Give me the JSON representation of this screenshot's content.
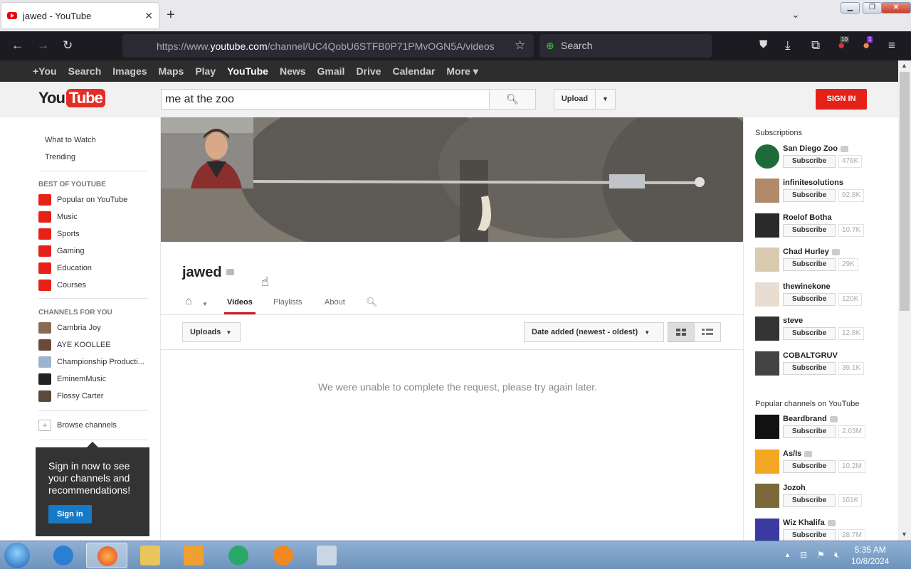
{
  "browser": {
    "tab_title": "jawed - YouTube",
    "url_pre": "https://www.",
    "url_domain": "youtube.com",
    "url_path": "/channel/UC4QobU6STFB0P71PMvOGN5A/videos",
    "search_placeholder": "Search",
    "badge_ext1": "10",
    "badge_ext2": "1"
  },
  "google_bar": {
    "items": [
      "+You",
      "Search",
      "Images",
      "Maps",
      "Play",
      "YouTube",
      "News",
      "Gmail",
      "Drive",
      "Calendar",
      "More ▾"
    ]
  },
  "masthead": {
    "logo_you": "You",
    "logo_tube": "Tube",
    "search_value": "me at the zoo",
    "upload_label": "Upload",
    "signin_label": "SIGN IN"
  },
  "guide": {
    "links": [
      "What to Watch",
      "Trending"
    ],
    "best_of_header": "BEST OF YOUTUBE",
    "best_of": [
      {
        "label": "Popular on YouTube",
        "color": "#e62117"
      },
      {
        "label": "Music",
        "color": "#e62117"
      },
      {
        "label": "Sports",
        "color": "#e62117"
      },
      {
        "label": "Gaming",
        "color": "#e62117"
      },
      {
        "label": "Education",
        "color": "#e62117"
      },
      {
        "label": "Courses",
        "color": "#e62117"
      }
    ],
    "channels_header": "CHANNELS FOR YOU",
    "channels": [
      {
        "label": "Cambria Joy",
        "color": "#8a6a55"
      },
      {
        "label": "AYE KOOLLEE",
        "color": "#6b4a3a"
      },
      {
        "label": "Championship Producti...",
        "color": "#9cb4cc"
      },
      {
        "label": "EminemMusic",
        "color": "#222222"
      },
      {
        "label": "Flossy Carter",
        "color": "#5a4a3a"
      }
    ],
    "browse_channels": "Browse channels",
    "signin_promo": "Sign in now to see your channels and recommendations!",
    "signin_promo_button": "Sign in"
  },
  "channel": {
    "name": "jawed",
    "tabs": [
      "Videos",
      "Playlists",
      "About"
    ],
    "active_tab": "Videos",
    "uploads_label": "Uploads",
    "sort_label": "Date added (newest - oldest)",
    "error_message": "We were unable to complete the request, please try again later."
  },
  "sidebar": {
    "subscriptions_header": "Subscriptions",
    "subscribe_label": "Subscribe",
    "subscriptions": [
      {
        "name": "San Diego Zoo",
        "count": "476K",
        "verified": true,
        "color": "#1e6b3a"
      },
      {
        "name": "infinitesolutions",
        "count": "92.8K",
        "verified": false,
        "color": "#b08a6a"
      },
      {
        "name": "Roelof Botha",
        "count": "10.7K",
        "verified": false,
        "color": "#2a2a2a"
      },
      {
        "name": "Chad Hurley",
        "count": "29K",
        "verified": true,
        "color": "#d9cbb0"
      },
      {
        "name": "thewinekone",
        "count": "120K",
        "verified": false,
        "color": "#e8ddd0"
      },
      {
        "name": "steve",
        "count": "12.8K",
        "verified": false,
        "color": "#333333"
      },
      {
        "name": "COBALTGRUV",
        "count": "39.1K",
        "verified": false,
        "color": "#444444"
      }
    ],
    "popular_header": "Popular channels on YouTube",
    "popular": [
      {
        "name": "Beardbrand",
        "count": "2.03M",
        "verified": true,
        "color": "#111111"
      },
      {
        "name": "As/Is",
        "count": "10.2M",
        "verified": true,
        "color": "#f5a623"
      },
      {
        "name": "Jozoh",
        "count": "101K",
        "verified": false,
        "color": "#7a6a3a"
      },
      {
        "name": "Wiz Khalifa",
        "count": "28.7M",
        "verified": true,
        "color": "#3a3aa0"
      }
    ]
  },
  "taskbar": {
    "time": "5:35 AM",
    "date": "10/8/2024"
  }
}
